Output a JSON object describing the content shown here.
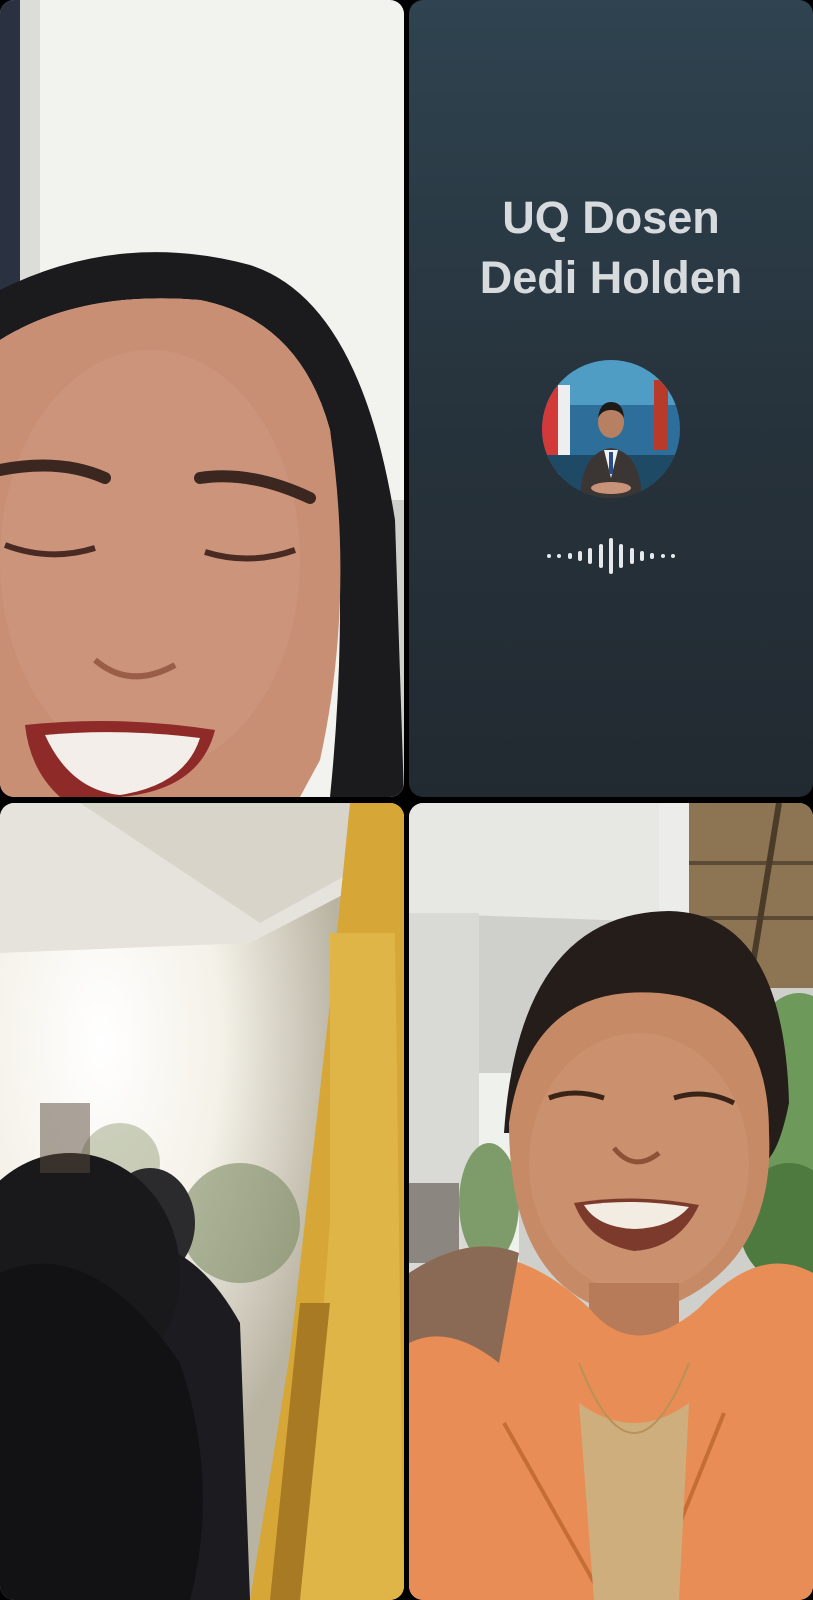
{
  "call": {
    "participants": [
      {
        "tile": "top-left",
        "type": "video"
      },
      {
        "tile": "top-right",
        "type": "audio-only",
        "name_line1": "UQ Dosen",
        "name_line2": "Dedi Holden",
        "avatar": "profile-photo"
      },
      {
        "tile": "bottom-left",
        "type": "video"
      },
      {
        "tile": "bottom-right",
        "type": "video"
      }
    ]
  },
  "colors": {
    "audio_tile_top": "#2f4350",
    "audio_tile_bottom": "#222a31",
    "name_text": "#d7dbde",
    "wave": "#e6e9eb"
  },
  "icons": {
    "audio_indicator": "audio-wave-icon"
  }
}
